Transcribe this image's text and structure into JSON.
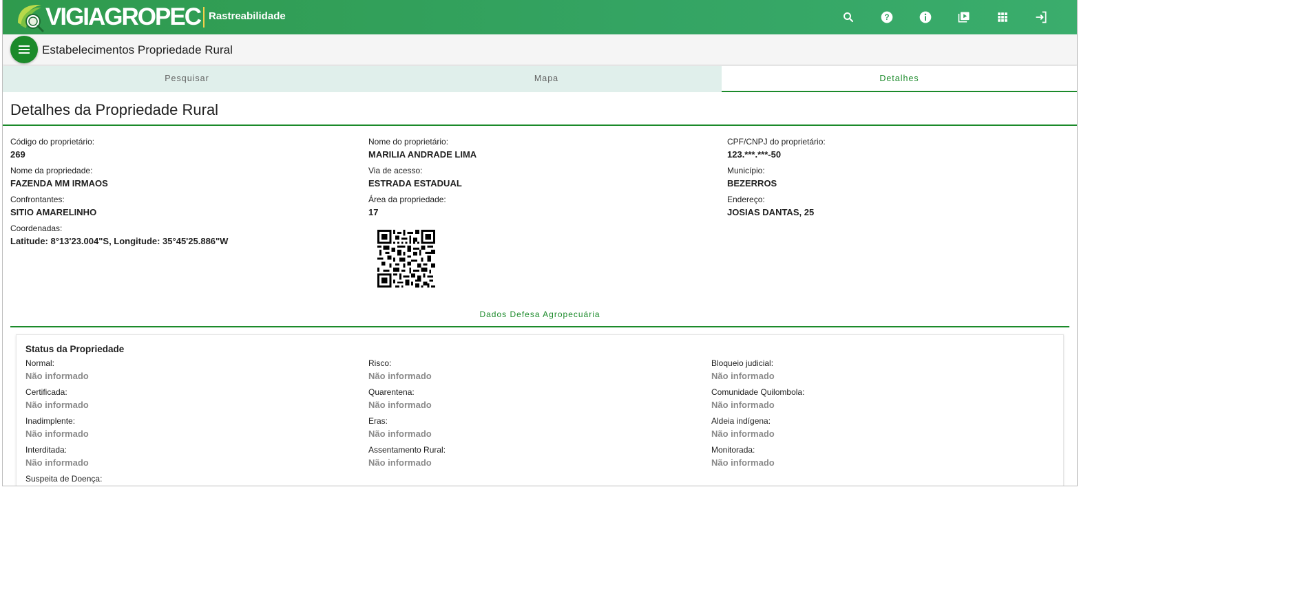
{
  "header": {
    "brand_name": "VIGIAGROPEC",
    "brand_sub": "Rastreabilidade",
    "icons": [
      "search-icon",
      "help-icon",
      "info-icon",
      "video-library-icon",
      "apps-icon",
      "logout-icon"
    ]
  },
  "titlebar": {
    "menu_icon": "menu-icon",
    "title": "Estabelecimentos Propriedade Rural"
  },
  "tabs": [
    {
      "label": "Pesquisar",
      "active": false
    },
    {
      "label": "Mapa",
      "active": false
    },
    {
      "label": "Detalhes",
      "active": true
    }
  ],
  "details": {
    "title": "Detalhes da Propriedade Rural",
    "fields": [
      {
        "label": "Código do proprietário:",
        "value": "269"
      },
      {
        "label": "Nome do proprietário:",
        "value": "MARILIA ANDRADE LIMA"
      },
      {
        "label": "CPF/CNPJ do proprietário:",
        "value": "123.***.***-50"
      },
      {
        "label": "Nome da propriedade:",
        "value": "FAZENDA MM IRMAOS"
      },
      {
        "label": "Via de acesso:",
        "value": "ESTRADA ESTADUAL"
      },
      {
        "label": "Município:",
        "value": "BEZERROS"
      },
      {
        "label": "Confrontantes:",
        "value": "SITIO AMARELINHO"
      },
      {
        "label": "Área da propriedade:",
        "value": "17"
      },
      {
        "label": "Endereço:",
        "value": "JOSIAS DANTAS, 25"
      },
      {
        "label": "Coordenadas:",
        "value": "Latitude: 8°13'23.004\"S, Longitude: 35°45'25.886\"W"
      }
    ]
  },
  "defesa": {
    "title": "Dados Defesa Agropecuária",
    "status_title": "Status da Propriedade",
    "fields": [
      {
        "label": "Normal:",
        "value": "Não informado"
      },
      {
        "label": "Risco:",
        "value": "Não informado"
      },
      {
        "label": "Bloqueio judicial:",
        "value": "Não informado"
      },
      {
        "label": "Certificada:",
        "value": "Não informado"
      },
      {
        "label": "Quarentena:",
        "value": "Não informado"
      },
      {
        "label": "Comunidade Quilombola:",
        "value": "Não informado"
      },
      {
        "label": "Inadimplente:",
        "value": "Não informado"
      },
      {
        "label": "Eras:",
        "value": "Não informado"
      },
      {
        "label": "Aldeia indígena:",
        "value": "Não informado"
      },
      {
        "label": "Interditada:",
        "value": "Não informado"
      },
      {
        "label": "Assentamento Rural:",
        "value": "Não informado"
      },
      {
        "label": "Monitorada:",
        "value": "Não informado"
      },
      {
        "label": "Suspeita de Doença:",
        "value": ""
      }
    ]
  },
  "colors": {
    "primary": "#1b8a2a",
    "header": "#34a463",
    "tab_bg": "#e0efeb",
    "muted_value": "#8a8a8a"
  }
}
